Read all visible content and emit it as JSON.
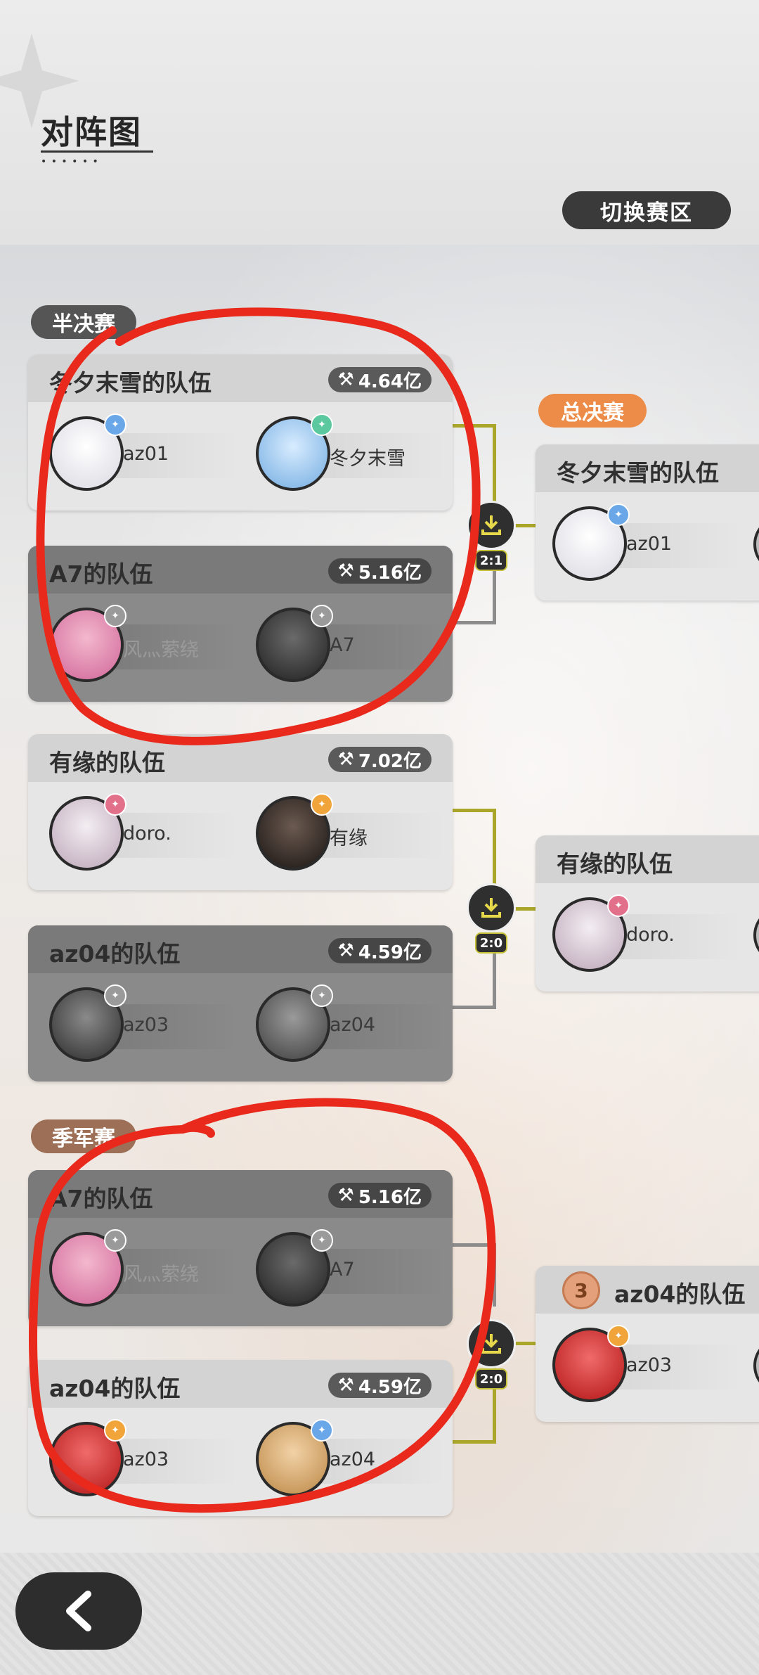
{
  "header": {
    "title": "对阵图",
    "switch_label": "切换赛区"
  },
  "sections": {
    "semifinal_label": "半决赛",
    "final_label": "总决赛",
    "third_place_label": "季军赛"
  },
  "matches": [
    {
      "score": "2:1",
      "teams": [
        {
          "name": "冬夕末雪的队伍",
          "power": "4.64亿",
          "result": "winner",
          "members": [
            {
              "name": "az01",
              "rank_color": "#6aa7e8"
            },
            {
              "name": "冬夕末雪",
              "rank_color": "#5cc8a0"
            }
          ]
        },
        {
          "name": "A7的队伍",
          "power": "5.16亿",
          "result": "loser",
          "members": [
            {
              "name": "风灬萦绕",
              "rank_color": "#9a9a9a"
            },
            {
              "name": "A7",
              "rank_color": "#9a9a9a"
            }
          ]
        }
      ]
    },
    {
      "score": "2:0",
      "teams": [
        {
          "name": "有缘的队伍",
          "power": "7.02亿",
          "result": "winner",
          "members": [
            {
              "name": "doro.",
              "rank_color": "#e2708a"
            },
            {
              "name": "有缘",
              "rank_color": "#f0a43a"
            }
          ]
        },
        {
          "name": "az04的队伍",
          "power": "4.59亿",
          "result": "loser",
          "members": [
            {
              "name": "az03",
              "rank_color": "#9a9a9a"
            },
            {
              "name": "az04",
              "rank_color": "#9a9a9a"
            }
          ]
        }
      ]
    },
    {
      "score": "2:0",
      "teams": [
        {
          "name": "A7的队伍",
          "power": "5.16亿",
          "result": "loser",
          "members": [
            {
              "name": "风灬萦绕",
              "rank_color": "#9a9a9a"
            },
            {
              "name": "A7",
              "rank_color": "#9a9a9a"
            }
          ]
        },
        {
          "name": "az04的队伍",
          "power": "4.59亿",
          "result": "winner",
          "members": [
            {
              "name": "az03",
              "rank_color": "#f0a43a"
            },
            {
              "name": "az04",
              "rank_color": "#6aa7e8"
            }
          ]
        }
      ]
    }
  ],
  "final_slots": [
    {
      "name": "冬夕末雪的队伍",
      "member": "az01",
      "rank_color": "#6aa7e8"
    },
    {
      "name": "有缘的队伍",
      "member": "doro.",
      "rank_color": "#e2708a"
    },
    {
      "name": "az04的队伍",
      "member": "az03",
      "rank_color": "#f0a43a",
      "place": "3"
    }
  ],
  "colors": {
    "annotation_red": "#e8291c",
    "connector_olive": "#a9a62a",
    "final_pill": "#ec8c48",
    "third_pill": "#9c6f56"
  }
}
